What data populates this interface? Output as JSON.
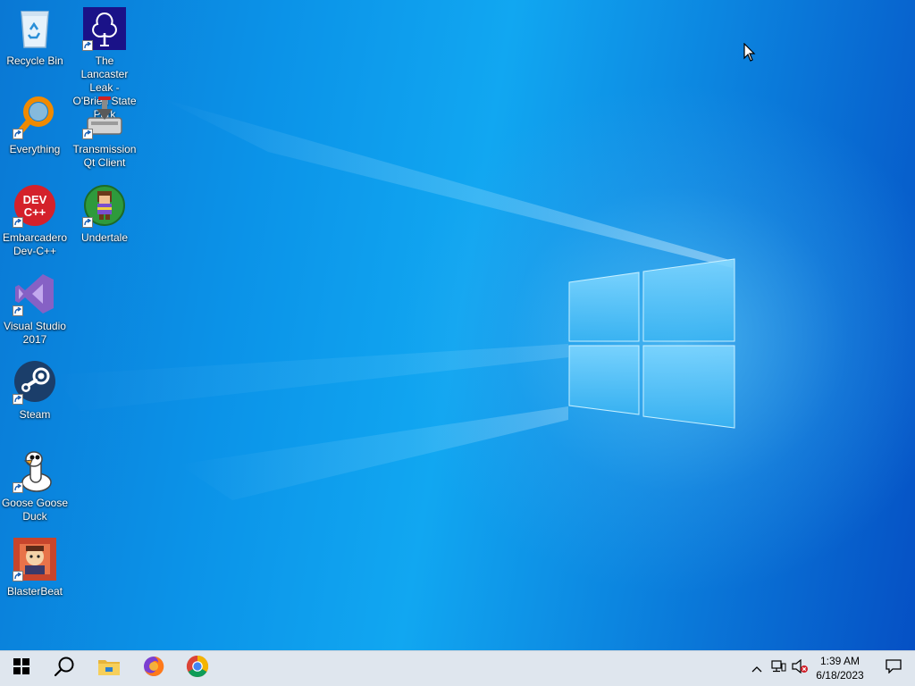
{
  "desktop": {
    "icons": [
      {
        "label": "Recycle Bin",
        "icon": "recycle-bin-icon",
        "shortcut": false
      },
      {
        "label": "The Lancaster Leak - O'Brien State Park",
        "icon": "lancaster-leak-icon",
        "shortcut": true
      },
      {
        "label": "Everything",
        "icon": "everything-search-icon",
        "shortcut": true
      },
      {
        "label": "Transmission Qt Client",
        "icon": "transmission-icon",
        "shortcut": true
      },
      {
        "label": "Embarcadero Dev-C++",
        "icon": "devcpp-icon",
        "shortcut": true,
        "glyph_text": "DEV C++"
      },
      {
        "label": "Undertale",
        "icon": "undertale-icon",
        "shortcut": true
      },
      {
        "label": "Visual Studio 2017",
        "icon": "visual-studio-icon",
        "shortcut": true
      },
      {
        "label": "Steam",
        "icon": "steam-icon",
        "shortcut": true
      },
      {
        "label": "Goose Goose Duck",
        "icon": "goose-goose-duck-icon",
        "shortcut": true
      },
      {
        "label": "BlasterBeat",
        "icon": "blasterbeat-icon",
        "shortcut": true
      }
    ]
  },
  "taskbar": {
    "start": "windows-logo-icon",
    "search": "search-icon",
    "pinned": [
      "file-explorer-icon",
      "firefox-icon",
      "chrome-icon"
    ],
    "tray": [
      "show-hidden-icons-icon",
      "network-icon",
      "volume-muted-icon"
    ],
    "clock": {
      "time": "1:39 AM",
      "date": "6/18/2023"
    },
    "notifications": "action-center-icon"
  },
  "colors": {
    "taskbar_bg": "#dfe6ee",
    "wallpaper_light": "#11a7f1",
    "wallpaper_dark": "#0550c4"
  }
}
